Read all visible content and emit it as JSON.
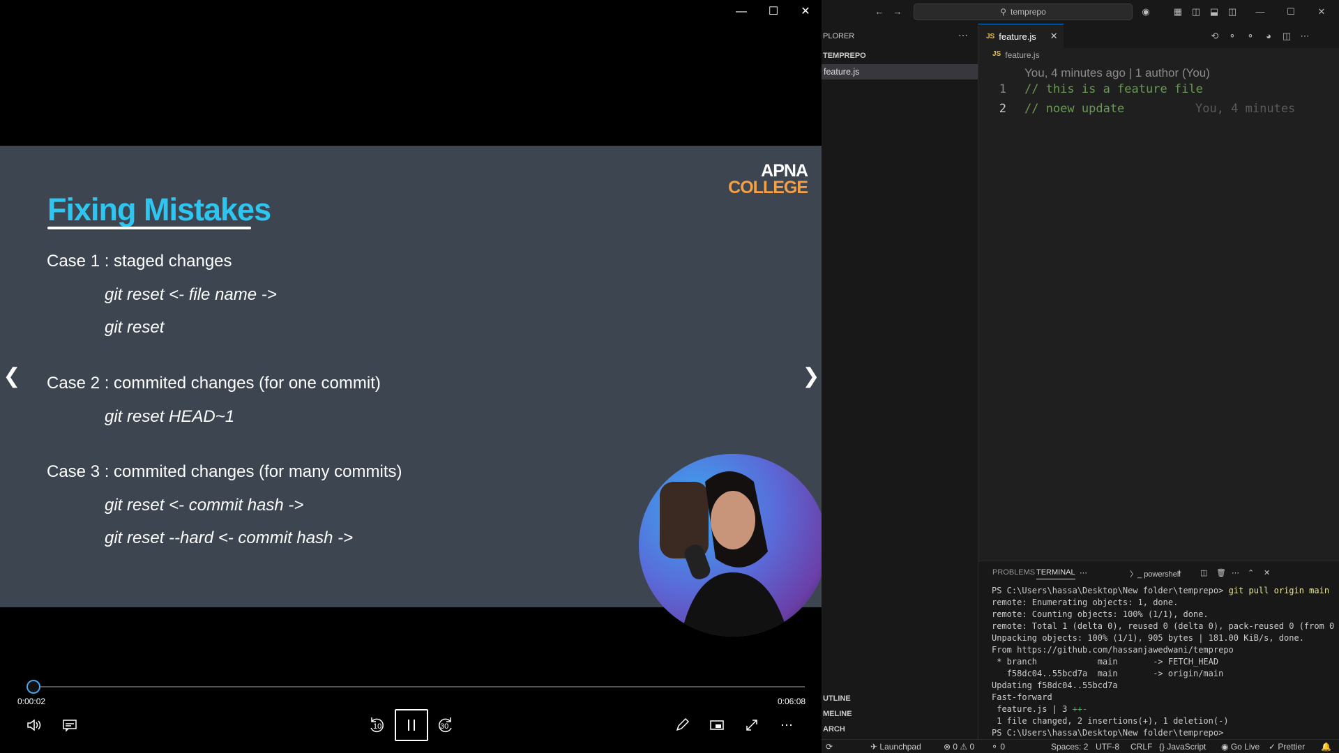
{
  "player": {
    "slide": {
      "title": "Fixing Mistakes",
      "logo_line1": "APNA",
      "logo_line2": "COLLEGE",
      "case1": "Case 1 : staged changes",
      "case1_cmd1": "git reset <- file name ->",
      "case1_cmd2": "git reset",
      "case2": "Case 2 : commited changes (for one commit)",
      "case2_cmd1": "git reset HEAD~1",
      "case3": "Case 3 : commited changes (for many commits)",
      "case3_cmd1": "git reset <- commit hash ->",
      "case3_cmd2": "git reset --hard <- commit hash ->"
    },
    "current_time": "0:00:02",
    "duration": "0:06:08",
    "progress_fraction": 0.005,
    "rewind_seconds": "10",
    "forward_seconds": "30"
  },
  "vscode": {
    "search_text": "temprepo",
    "sidebar": {
      "title": "PLORER",
      "folder": "TEMPREPO",
      "file": "feature.js",
      "sections": [
        "UTLINE",
        "MELINE",
        "ARCH"
      ]
    },
    "tab": {
      "badge": "JS",
      "label": "feature.js"
    },
    "breadcrumb": {
      "badge": "JS",
      "file": "feature.js"
    },
    "editor": {
      "blame_header": "You, 4 minutes ago | 1 author (You)",
      "lines": [
        {
          "num": "1",
          "text": "// this is a feature file"
        },
        {
          "num": "2",
          "text": "// noew update"
        }
      ],
      "inline_blame": "You, 4 minutes"
    },
    "panel": {
      "tabs": [
        "PROBLEMS",
        "TERMINAL"
      ],
      "shell": "powershell",
      "terminal": {
        "prompt": "PS C:\\Users\\hassa\\Desktop\\New folder\\temprepo>",
        "command": "git pull origin main",
        "lines": [
          "remote: Enumerating objects: 1, done.",
          "remote: Counting objects: 100% (1/1), done.",
          "remote: Total 1 (delta 0), reused 0 (delta 0), pack-reused 0 (from 0",
          "Unpacking objects: 100% (1/1), 905 bytes | 181.00 KiB/s, done.",
          "From https://github.com/hassanjawedwani/temprepo",
          " * branch            main       -> FETCH_HEAD",
          "   f58dc04..55bcd7a  main       -> origin/main",
          "Updating f58dc04..55bcd7a",
          "Fast-forward"
        ],
        "stat_file": " feature.js | 3 ",
        "stat_plus": "++",
        "stat_minus": "-",
        "summary": " 1 file changed, 2 insertions(+), 1 deletion(-)",
        "final_prompt": "PS C:\\Users\\hassa\\Desktop\\New folder\\temprepo> "
      }
    },
    "statusbar": {
      "launchpad": "Launchpad",
      "errors": "0",
      "warnings": "0",
      "ports": "0",
      "spaces": "Spaces: 2",
      "encoding": "UTF-8",
      "eol": "CRLF",
      "language": "JavaScript",
      "golive": "Go Live",
      "prettier": "Prettier"
    }
  }
}
